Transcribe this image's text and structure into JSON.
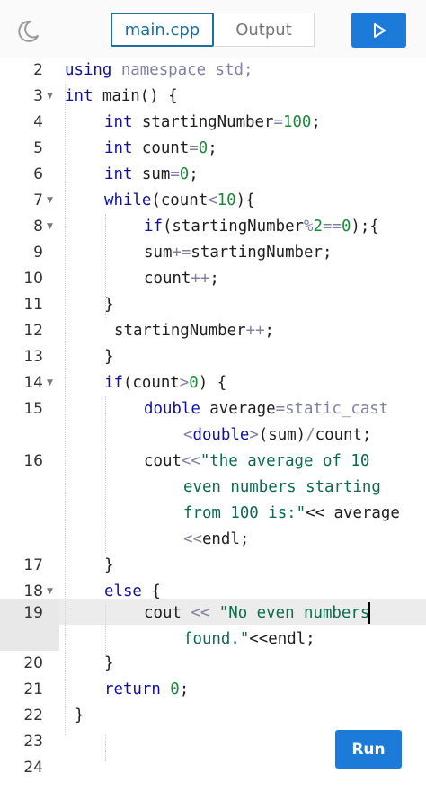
{
  "header": {
    "theme_toggle_icon": "moon-icon",
    "tabs": [
      {
        "label": "main.cpp",
        "active": true
      },
      {
        "label": "Output",
        "active": false
      }
    ],
    "play_icon": "play-icon"
  },
  "editor": {
    "highlighted_line": 19,
    "lines": [
      {
        "n": "2"
      },
      {
        "n": "3"
      },
      {
        "n": "4"
      },
      {
        "n": "5"
      },
      {
        "n": "6"
      },
      {
        "n": "7"
      },
      {
        "n": "8"
      },
      {
        "n": "9"
      },
      {
        "n": "10"
      },
      {
        "n": "11"
      },
      {
        "n": "12"
      },
      {
        "n": "13"
      },
      {
        "n": "14"
      },
      {
        "n": "15"
      },
      {
        "n": "16"
      },
      {
        "n": "17"
      },
      {
        "n": "18"
      },
      {
        "n": "19"
      },
      {
        "n": "20"
      },
      {
        "n": "21"
      },
      {
        "n": "22"
      },
      {
        "n": "23"
      },
      {
        "n": "24"
      }
    ],
    "code": {
      "l2": {
        "kw": "using",
        "rest": " namespace std;"
      },
      "l3": {
        "kw": "int",
        "rest": " main() {"
      },
      "l4": {
        "kw": "int",
        "a": " startingNumber",
        "op": "=",
        "num": "100",
        "end": ";"
      },
      "l5": {
        "kw": "int",
        "a": " count",
        "op": "=",
        "num": "0",
        "end": ";"
      },
      "l6": {
        "kw": "int",
        "a": " sum",
        "op": "=",
        "num": "0",
        "end": ";"
      },
      "l7": {
        "kw": "while",
        "a": "(count",
        "op": "<",
        "num": "10",
        "end": "){"
      },
      "l8": {
        "kw": "if",
        "a": "(startingNumber",
        "op": "%",
        "num": "2",
        "op2": "==",
        "num2": "0",
        "end": ");{"
      },
      "l9": {
        "a": "sum",
        "op": "+=",
        "end": "startingNumber;"
      },
      "l10": {
        "a": "count",
        "op": "++",
        "end": ";"
      },
      "l11": {
        "a": "}"
      },
      "l12": {
        "a": "startingNumber",
        "op": "++",
        "end": ";"
      },
      "l13": {
        "a": "}"
      },
      "l14": {
        "kw": "if",
        "a": "(count",
        "op": ">",
        "num": "0",
        "end": ") {"
      },
      "l15a": {
        "kw": "double",
        "a": " average",
        "op": "=",
        "end": "static_cast"
      },
      "l15b": {
        "op": "<",
        "kw": "double",
        "op2": ">",
        "a": "(sum)",
        "op3": "/",
        "end": "count;"
      },
      "l16a": {
        "a": "cout",
        "op": "<<",
        "str": "\"the average of 10"
      },
      "l16b": {
        "str": "even numbers starting"
      },
      "l16c": {
        "str": "from 100 is:\"",
        "op": "<<",
        "end": " average"
      },
      "l16d": {
        "op": "<<",
        "end": "endl;"
      },
      "l17": {
        "a": "}"
      },
      "l18": {
        "kw": "else",
        "a": " {"
      },
      "l19a": {
        "a": "cout ",
        "op": "<<",
        "str": " \"No even numbers"
      },
      "l19b": {
        "str": "found.\"",
        "op": "<<",
        "end": "endl;"
      },
      "l20": {
        "a": "}"
      },
      "l21": {
        "kw": "return",
        "num": " 0",
        "end": ";"
      },
      "l22": {
        "a": "}"
      }
    }
  },
  "run_button": {
    "label": "Run"
  }
}
